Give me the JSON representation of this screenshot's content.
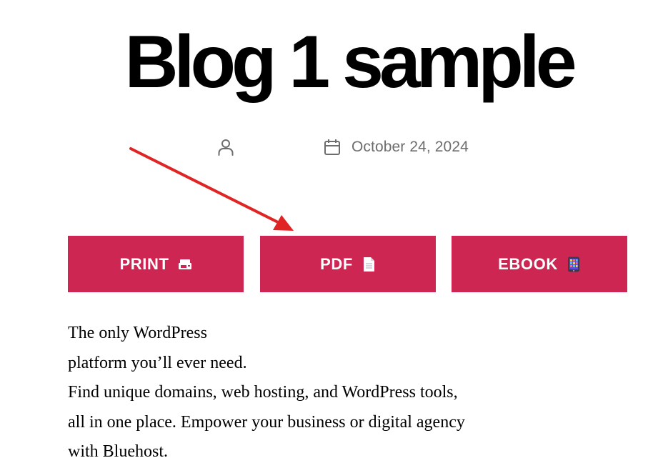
{
  "post": {
    "title": "Blog 1 sample",
    "date": "October 24, 2024"
  },
  "share_buttons": {
    "print_label": "PRINT",
    "pdf_label": "PDF",
    "ebook_label": "EBOOK"
  },
  "icons": {
    "author": "user-icon",
    "date": "calendar-icon",
    "print": "printer-icon",
    "pdf": "document-icon",
    "ebook": "tablet-icon",
    "annotation": "arrow-annotation"
  },
  "colors": {
    "accent": "#cd2653",
    "meta_text": "#6d6d6d",
    "annotation_arrow": "#e02424"
  },
  "content": {
    "lines": [
      "The only WordPress",
      "platform you’ll ever need.",
      "Find unique domains, web hosting, and WordPress tools,",
      "all in one place. Empower your business or digital agency",
      "with Bluehost."
    ]
  }
}
